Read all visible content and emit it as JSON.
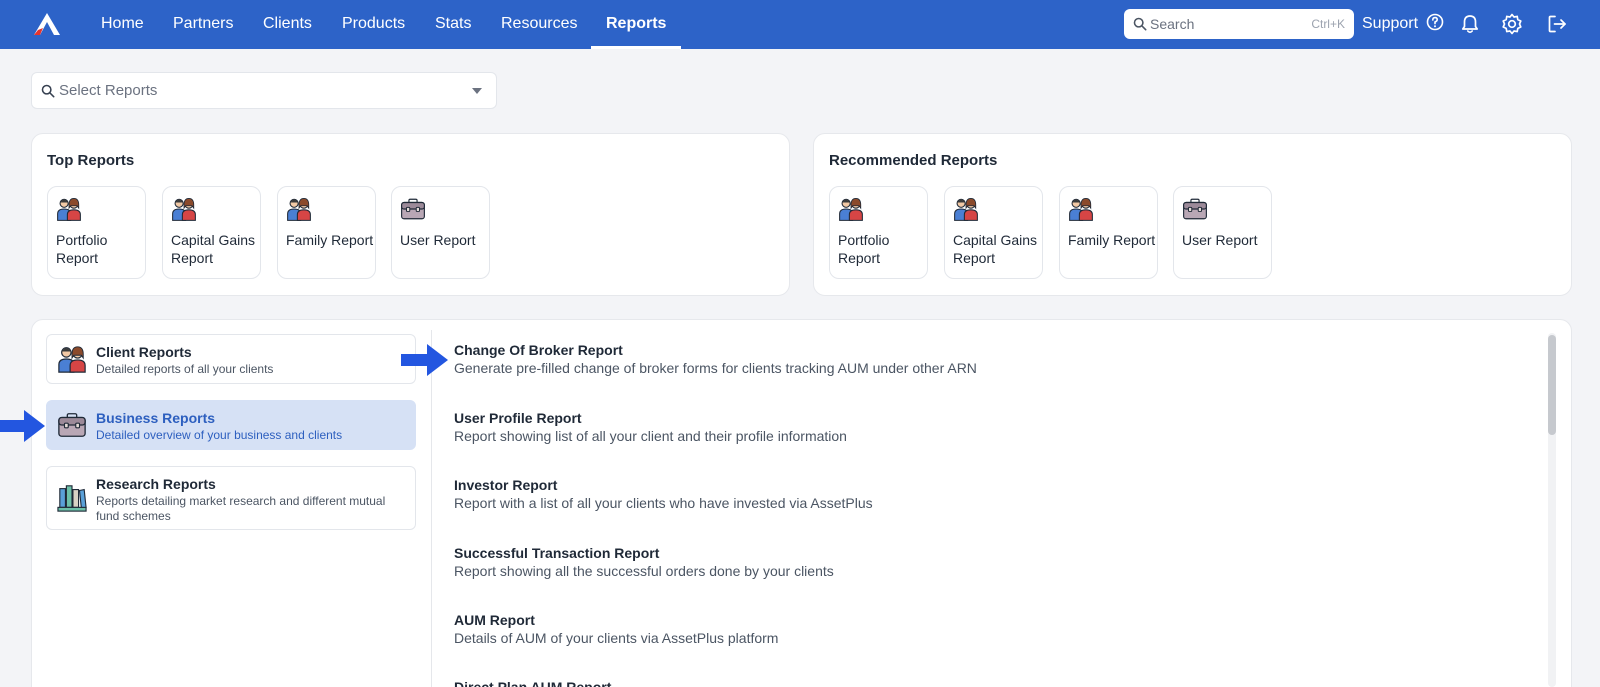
{
  "nav": {
    "items": [
      "Home",
      "Partners",
      "Clients",
      "Products",
      "Stats",
      "Resources",
      "Reports"
    ],
    "active": "Reports",
    "search_placeholder": "Search",
    "search_shortcut": "Ctrl+K",
    "support_label": "Support"
  },
  "select_reports": {
    "placeholder": "Select Reports"
  },
  "top_reports": {
    "title": "Top Reports",
    "tiles": [
      {
        "label": "Portfolio Report",
        "icon": "family-icon"
      },
      {
        "label": "Capital Gains Report",
        "icon": "family-icon"
      },
      {
        "label": "Family Report",
        "icon": "family-icon"
      },
      {
        "label": "User Report",
        "icon": "briefcase-icon"
      }
    ]
  },
  "recommended_reports": {
    "title": "Recommended Reports",
    "tiles": [
      {
        "label": "Portfolio Report",
        "icon": "family-icon"
      },
      {
        "label": "Capital Gains Report",
        "icon": "family-icon"
      },
      {
        "label": "Family Report",
        "icon": "family-icon"
      },
      {
        "label": "User Report",
        "icon": "briefcase-icon"
      }
    ]
  },
  "categories": [
    {
      "title": "Client Reports",
      "desc": "Detailed reports of all your clients",
      "icon": "family-icon",
      "active": false
    },
    {
      "title": "Business Reports",
      "desc": "Detailed overview of your business and clients",
      "icon": "briefcase-icon",
      "active": true
    },
    {
      "title": "Research Reports",
      "desc": "Reports detailing market research and different mutual fund schemes",
      "icon": "books-icon",
      "active": false
    }
  ],
  "reports": [
    {
      "title": "Change Of Broker Report",
      "desc": "Generate pre-filled change of broker forms for clients tracking AUM under other ARN"
    },
    {
      "title": "User Profile Report",
      "desc": "Report showing list of all your client and their profile information"
    },
    {
      "title": "Investor Report",
      "desc": "Report with a list of all your clients who have invested via AssetPlus"
    },
    {
      "title": "Successful Transaction Report",
      "desc": "Report showing all the successful orders done by your clients"
    },
    {
      "title": "AUM Report",
      "desc": "Details of AUM of your clients via AssetPlus platform"
    },
    {
      "title": "Direct Plan AUM Report",
      "desc": ""
    }
  ],
  "colors": {
    "nav_bg": "#2d63c8",
    "active_category_bg": "#d6e1f5",
    "active_category_text": "#2d5fbf",
    "arrow": "#2356e0"
  }
}
